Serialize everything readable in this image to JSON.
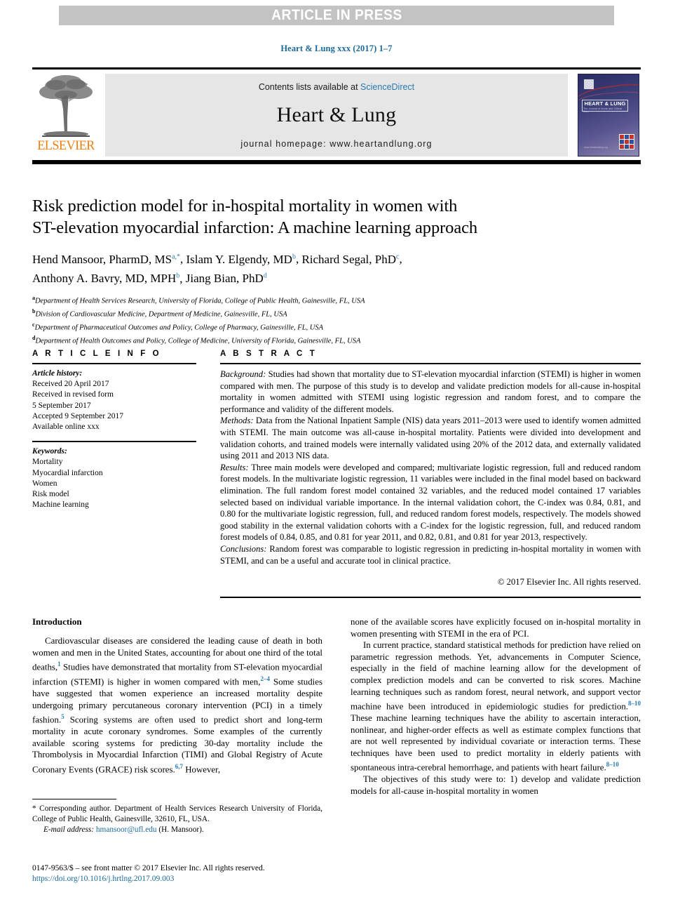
{
  "banner": {
    "text": "ARTICLE IN PRESS",
    "bg_color": "#c3c3c3",
    "text_color": "#ffffff"
  },
  "running_head": "Heart & Lung xxx (2017) 1–7",
  "journal_header": {
    "publisher_name": "ELSEVIER",
    "contents_prefix": "Contents lists available at ",
    "contents_link": "ScienceDirect",
    "journal_title": "Heart & Lung",
    "homepage": "journal homepage: www.heartandlung.org",
    "cover": {
      "title": "HEART & LUNG",
      "subtitle": "The Journal of Acute and Critical Care",
      "url": "www.heartandlung.org"
    },
    "link_color": "#2a7ab0"
  },
  "article": {
    "title_line1": "Risk prediction model for in-hospital mortality in women with",
    "title_line2": "ST-elevation myocardial infarction: A machine learning approach",
    "authors": [
      {
        "name": "Hend Mansoor, PharmD, MS",
        "marks": "a,*"
      },
      {
        "name": "Islam Y. Elgendy, MD",
        "marks": "b"
      },
      {
        "name": "Richard Segal, PhD",
        "marks": "c"
      },
      {
        "name": "Anthony A. Bavry, MD, MPH",
        "marks": "b"
      },
      {
        "name": "Jiang Bian, PhD",
        "marks": "d"
      }
    ],
    "affiliations": [
      {
        "mark": "a",
        "text": "Department of Health Services Research, University of Florida, College of Public Health, Gainesville, FL, USA"
      },
      {
        "mark": "b",
        "text": "Division of Cardiovascular Medicine, Department of Medicine, Gainesville, FL, USA"
      },
      {
        "mark": "c",
        "text": "Department of Pharmaceutical Outcomes and Policy, College of Pharmacy, Gainesville, FL, USA"
      },
      {
        "mark": "d",
        "text": "Department of Health Outcomes and Policy, College of Medicine, University of Florida, Gainesville, FL, USA"
      }
    ]
  },
  "article_info": {
    "heading": "A R T I C L E  I N F O",
    "history_label": "Article history:",
    "history": [
      "Received 20 April 2017",
      "Received in revised form",
      "5 September 2017",
      "Accepted 9 September 2017",
      "Available online xxx"
    ],
    "keywords_label": "Keywords:",
    "keywords": [
      "Mortality",
      "Myocardial infarction",
      "Women",
      "Risk model",
      "Machine learning"
    ]
  },
  "abstract": {
    "heading": "A B S T R A C T",
    "sections": [
      {
        "label": "Background:",
        "text": " Studies had shown that mortality due to ST-elevation myocardial infarction (STEMI) is higher in women compared with men. The purpose of this study is to develop and validate prediction models for all-cause in-hospital mortality in women admitted with STEMI using logistic regression and random forest, and to compare the performance and validity of the different models."
      },
      {
        "label": "Methods:",
        "text": " Data from the National Inpatient Sample (NIS) data years 2011–2013 were used to identify women admitted with STEMI. The main outcome was all-cause in-hospital mortality. Patients were divided into development and validation cohorts, and trained models were internally validated using 20% of the 2012 data, and externally validated using 2011 and 2013 NIS data."
      },
      {
        "label": "Results:",
        "text": " Three main models were developed and compared; multivariate logistic regression, full and reduced random forest models. In the multivariate logistic regression, 11 variables were included in the final model based on backward elimination. The full random forest model contained 32 variables, and the reduced model contained 17 variables selected based on individual variable importance. In the internal validation cohort, the C-index was 0.84, 0.81, and 0.80 for the multivariate logistic regression, full, and reduced random forest models, respectively. The models showed good stability in the external validation cohorts with a C-index for the logistic regression, full, and reduced random forest models of 0.84, 0.85, and 0.81 for year 2011, and 0.82, 0.81, and 0.81 for year 2013, respectively."
      },
      {
        "label": "Conclusions:",
        "text": " Random forest was comparable to logistic regression in predicting in-hospital mortality in women with STEMI, and can be a useful and accurate tool in clinical practice."
      }
    ],
    "copyright": "© 2017 Elsevier Inc. All rights reserved."
  },
  "introduction": {
    "heading": "Introduction",
    "left_paragraph_html": "Cardiovascular diseases are considered the leading cause of death in both women and men in the United States, accounting for about one third of the total deaths,<sup class=\"cite\">1</sup> Studies have demonstrated that mortality from ST-elevation myocardial infarction (STEMI) is higher in women compared with men,<sup class=\"cite\">2–4</sup> Some studies have suggested that women experience an increased mortality despite undergoing primary percutaneous coronary intervention (PCI) in a timely fashion.<sup class=\"cite\">5</sup> Scoring systems are often used to predict short and long-term mortality in acute coronary syndromes. Some examples of the currently available scoring systems for predicting 30-day mortality include the Thrombolysis in Myocardial Infarction (TIMI) and Global Registry of Acute Coronary Events (GRACE) risk scores.<sup class=\"cite\">6,7</sup> However,",
    "right_paragraph_1_html": "none of the available scores have explicitly focused on in-hospital mortality in women presenting with STEMI in the era of PCI.",
    "right_paragraph_2_html": "In current practice, standard statistical methods for prediction have relied on parametric regression methods. Yet, advancements in Computer Science, especially in the field of machine learning allow for the development of complex prediction models and can be converted to risk scores. Machine learning techniques such as random forest, neural network, and support vector machine have been introduced in epidemiologic studies for prediction.<sup class=\"cite\">8–10</sup> These machine learning techniques have the ability to ascertain interaction, nonlinear, and higher-order effects as well as estimate complex functions that are not well represented by individual covariate or interaction terms. These techniques have been used to predict mortality in elderly patients with spontaneous intra-cerebral hemorrhage, and patients with heart failure.<sup class=\"cite\">8–10</sup>",
    "right_paragraph_3_html": "The objectives of this study were to: 1) develop and validate prediction models for all-cause in-hospital mortality in women"
  },
  "footnotes": {
    "corresponding_html": "* Corresponding author. Department of Health Services Research University of Florida, College of Public Health, Gainesville, 32610, FL, USA.",
    "email_label": "E-mail address:",
    "email": "hmansoor@ufl.edu",
    "email_owner": "(H. Mansoor).",
    "issn_line": "0147-9563/$ – see front matter © 2017 Elsevier Inc. All rights reserved.",
    "doi": "https://doi.org/10.1016/j.hrtlng.2017.09.003",
    "link_color": "#1b6a9c"
  }
}
